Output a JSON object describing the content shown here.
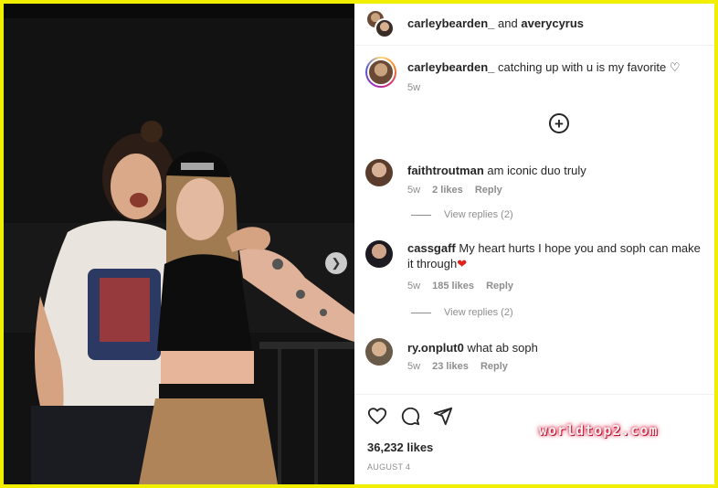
{
  "header": {
    "user1": "carleybearden_",
    "joiner": "and",
    "user2": "averycyrus"
  },
  "caption": {
    "username": "carleybearden_",
    "text": "catching up with u is my favorite ♡",
    "time": "5w"
  },
  "comments": [
    {
      "username": "faithtroutman",
      "text": "am iconic duo truly",
      "time": "5w",
      "likes": "2 likes",
      "reply": "Reply",
      "view_replies": "View replies (2)"
    },
    {
      "username": "cassgaff",
      "text": "My heart hurts I hope you and soph can make it through",
      "emoji": "❤",
      "time": "5w",
      "likes": "185 likes",
      "reply": "Reply",
      "view_replies": "View replies (2)"
    },
    {
      "username": "ry.onplut0",
      "text": "what ab soph",
      "time": "5w",
      "likes": "23 likes",
      "reply": "Reply"
    }
  ],
  "post": {
    "likes": "36,232 likes",
    "date": "AUGUST 4"
  },
  "watermark": "worldtop2.com",
  "icons": {
    "next": "chevron-right-icon",
    "load_more": "plus-circle-icon",
    "like": "heart-icon",
    "comment": "comment-icon",
    "share": "paper-plane-icon"
  },
  "colors": {
    "border": "#f2ee00",
    "muted_text": "#8e8e8e",
    "heart_emoji": "#e0201c",
    "watermark_glow": "#d92040"
  }
}
